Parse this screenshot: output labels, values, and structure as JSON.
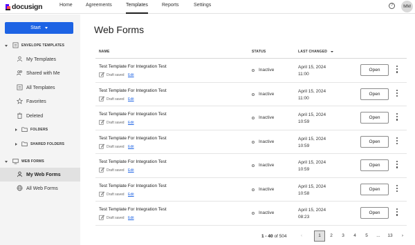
{
  "app": {
    "logo_text": "docusign"
  },
  "nav": {
    "items": [
      {
        "label": "Home"
      },
      {
        "label": "Agreements"
      },
      {
        "label": "Templates"
      },
      {
        "label": "Reports"
      },
      {
        "label": "Settings"
      }
    ],
    "active": "Templates",
    "help_glyph": "?",
    "avatar_initials": "MM"
  },
  "sidebar": {
    "start_label": "Start",
    "envelope_section": "ENVELOPE TEMPLATES",
    "my_templates": "My Templates",
    "shared_with_me": "Shared with Me",
    "all_templates": "All Templates",
    "favorites": "Favorites",
    "deleted": "Deleted",
    "folders": "FOLDERS",
    "shared_folders": "SHARED FOLDERS",
    "web_forms_section": "WEB FORMS",
    "my_web_forms": "My Web Forms",
    "all_web_forms": "All Web Forms"
  },
  "main": {
    "title": "Web Forms",
    "columns": {
      "name": "NAME",
      "status": "STATUS",
      "last_changed": "LAST CHANGED"
    },
    "draft_label": "Draft saved",
    "edit_label": "Edit",
    "open_label": "Open",
    "rows": [
      {
        "name": "Test Template For Integration Test",
        "status": "Inactive",
        "date": "April 15, 2024",
        "time": "11:00"
      },
      {
        "name": "Test Template For Integration Test",
        "status": "Inactive",
        "date": "April 15, 2024",
        "time": "11:00"
      },
      {
        "name": "Test Template For Integration Test",
        "status": "Inactive",
        "date": "April 15, 2024",
        "time": "10:59"
      },
      {
        "name": "Test Template For Integration Test",
        "status": "Inactive",
        "date": "April 15, 2024",
        "time": "10:59"
      },
      {
        "name": "Test Template For Integration Test",
        "status": "Inactive",
        "date": "April 15, 2024",
        "time": "10:59"
      },
      {
        "name": "Test Template For Integration Test",
        "status": "Inactive",
        "date": "April 15, 2024",
        "time": "10:58"
      },
      {
        "name": "Test Template For Integration Test",
        "status": "Inactive",
        "date": "April 15, 2024",
        "time": "08:23"
      }
    ]
  },
  "pagination": {
    "range": "1 - 40",
    "of_label": "of",
    "total": "504",
    "pages": [
      "1",
      "2",
      "3",
      "4",
      "5",
      "...",
      "13"
    ],
    "current": "1",
    "prev_glyph": "‹",
    "next_glyph": "›"
  },
  "colors": {
    "accent": "#1d63e4",
    "active_bg": "#e1e1e1",
    "sidebar_bg": "#f4f4f4"
  }
}
